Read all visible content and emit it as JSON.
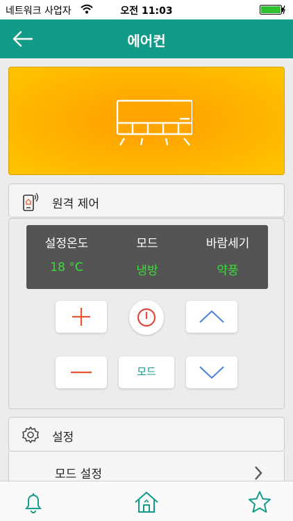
{
  "status": {
    "carrier": "네트워크 사업자",
    "time": "오전 11:03"
  },
  "header": {
    "title": "에어컨",
    "back_icon": "back-arrow-icon"
  },
  "banner": {
    "icon": "air-conditioner-icon",
    "colors": {
      "outer": "#ffc400",
      "inner": "#ffa200"
    }
  },
  "remote": {
    "section_label": "원격 제어",
    "icon": "remote-phone-icon",
    "display": {
      "columns": [
        {
          "header": "설정온도",
          "value": "18 °C"
        },
        {
          "header": "모드",
          "value": "냉방"
        },
        {
          "header": "바람세기",
          "value": "약풍"
        }
      ]
    },
    "buttons": {
      "temp_up_icon": "plus-icon",
      "temp_down_icon": "minus-icon",
      "power_icon": "power-icon",
      "mode_label": "모드",
      "fan_up_icon": "chevron-up-icon",
      "fan_down_icon": "chevron-down-icon"
    }
  },
  "settings": {
    "section_label": "설정",
    "icon": "gear-icon",
    "items": [
      {
        "label": "모드 설정"
      }
    ]
  },
  "tabbar": {
    "tabs": [
      {
        "icon": "bell-icon"
      },
      {
        "icon": "home-icon"
      },
      {
        "icon": "star-icon"
      }
    ]
  },
  "colors": {
    "accent": "#139b89",
    "display_value": "#3bdc3b",
    "plus_minus": "#e8542c",
    "chevron": "#4a7fd6",
    "power": "#e0473a"
  }
}
